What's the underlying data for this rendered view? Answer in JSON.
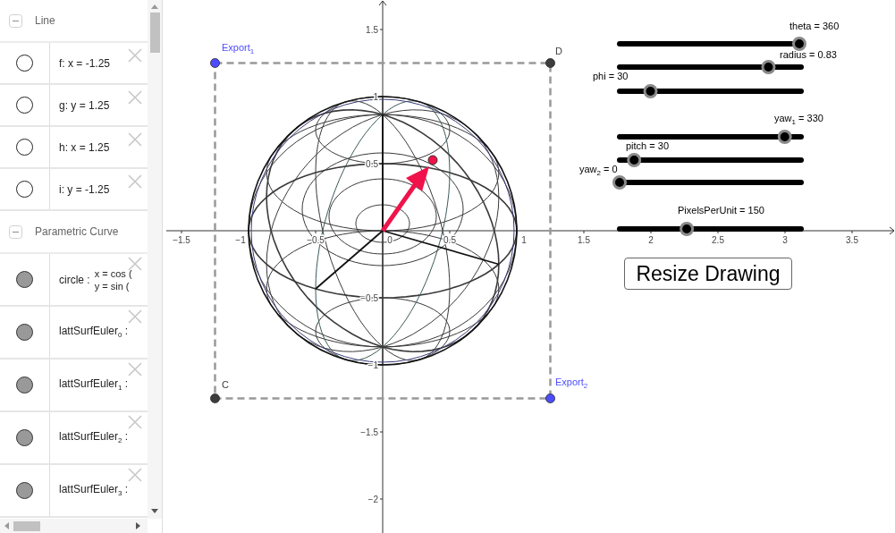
{
  "algebra": {
    "sections": [
      {
        "title": "Line",
        "expanded": true,
        "items": [
          {
            "kind": "plain",
            "label": "f: x = -1.25",
            "visible": false
          },
          {
            "kind": "plain",
            "label": "g: y = 1.25",
            "visible": false
          },
          {
            "kind": "plain",
            "label": "h: x = 1.25",
            "visible": false
          },
          {
            "kind": "plain",
            "label": "i: y = -1.25",
            "visible": false
          }
        ]
      },
      {
        "title": "Parametric Curve",
        "expanded": true,
        "items": [
          {
            "kind": "curve",
            "label": "circle :",
            "definition": [
              "x = cos (",
              "y = sin ("
            ],
            "visible": true
          },
          {
            "kind": "plain",
            "label": "lattSurfEuler$_{0}$ :",
            "visible": true
          },
          {
            "kind": "plain",
            "label": "lattSurfEuler$_{1}$ :",
            "visible": true
          },
          {
            "kind": "plain",
            "label": "lattSurfEuler$_{2}$ :",
            "visible": true
          },
          {
            "kind": "plain",
            "label": "lattSurfEuler$_{3}$ :",
            "visible": true
          }
        ]
      }
    ]
  },
  "graphics": {
    "x_axis_labels": [
      "−1.5",
      "−1",
      "−0.5",
      "0",
      "0.5",
      "1",
      "1.5",
      "2",
      "2.5",
      "3",
      "3.5"
    ],
    "y_axis_labels": [
      "1.5",
      "1",
      "0.5",
      "−0.5",
      "−1",
      "−1.5",
      "−2"
    ],
    "points": [
      {
        "label": "Export$_{1}$",
        "color": "#4d4dff"
      },
      {
        "label": "D",
        "color": "#3d3d3d"
      },
      {
        "label": "C",
        "color": "#3d3d3d"
      },
      {
        "label": "Export$_{2}$",
        "color": "#4d4dff"
      }
    ],
    "sliders": [
      {
        "label": "theta = 360",
        "level": 0.99
      },
      {
        "label": "radius = 0.83",
        "level": 0.82
      },
      {
        "label": "phi = 30",
        "level": 0.17
      },
      {
        "label": "yaw$_{1}$ = 330",
        "level": 0.91
      },
      {
        "label": "pitch = 30",
        "level": 0.08
      },
      {
        "label": "yaw$_{2}$ = 0",
        "level": 0.0
      },
      {
        "label": "PixelsPerUnit = 150",
        "level": 0.37
      }
    ],
    "button": "Resize Drawing"
  }
}
